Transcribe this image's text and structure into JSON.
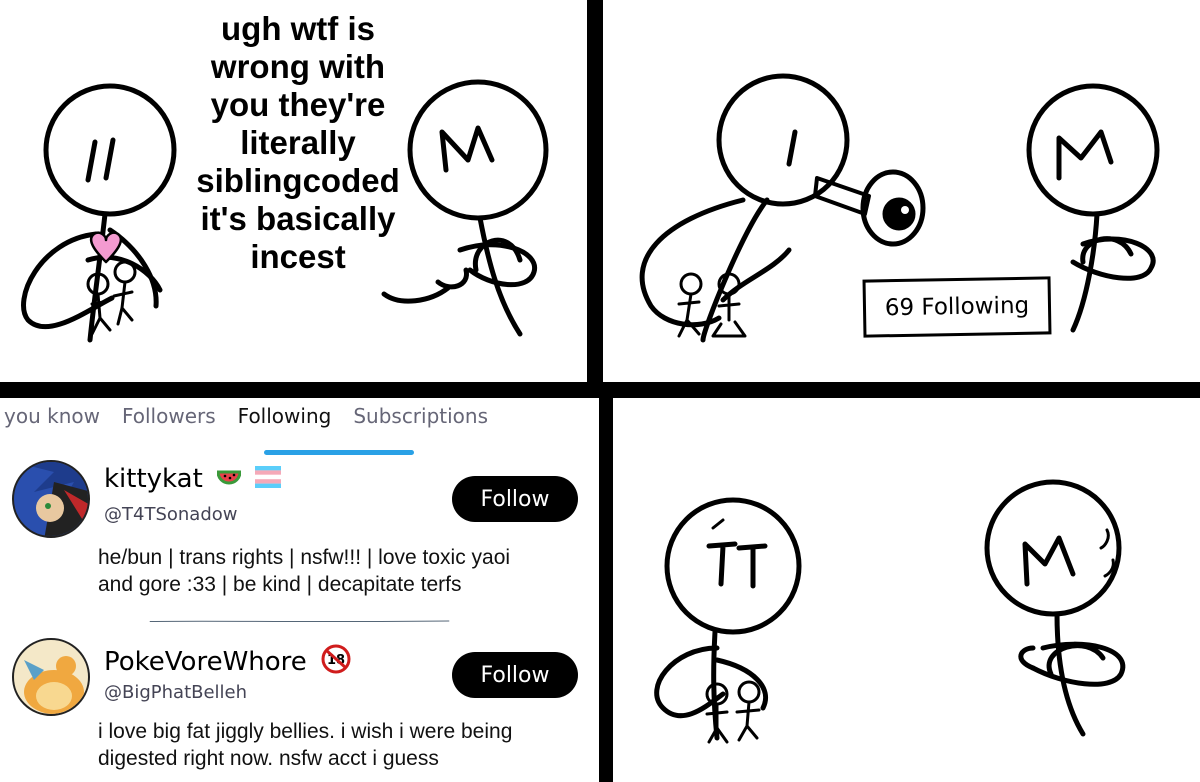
{
  "panel1": {
    "speech_lines": [
      "ugh wtf is",
      "wrong with",
      "you they're",
      "literally",
      "siblingcoded",
      "it's basically",
      "incest"
    ]
  },
  "panel2": {
    "sign_text": "69 Following"
  },
  "profile": {
    "tabs": [
      {
        "label": "you know",
        "active": false
      },
      {
        "label": "Followers",
        "active": false
      },
      {
        "label": "Following",
        "active": true
      },
      {
        "label": "Subscriptions",
        "active": false
      }
    ],
    "accent_color": "#2aa1e6",
    "accounts": [
      {
        "name": "kittykat",
        "handle": "@T4TSonadow",
        "bio_lines": [
          "he/bun | trans rights | nsfw!!! | love toxic yaoi",
          "and gore :33 | be kind | decapitate terfs"
        ],
        "follow_label": "Follow",
        "badges": [
          "watermelon-emoji",
          "trans-flag-emoji"
        ]
      },
      {
        "name": "PokeVoreWhore",
        "handle": "@BigPhatBelleh",
        "bio_lines": [
          "i love big fat jiggly bellies. i wish i were being",
          "digested right now. nsfw acct i guess"
        ],
        "follow_label": "Follow",
        "badges": [
          "no-under-18-emoji"
        ],
        "badge_text": "18"
      }
    ]
  }
}
